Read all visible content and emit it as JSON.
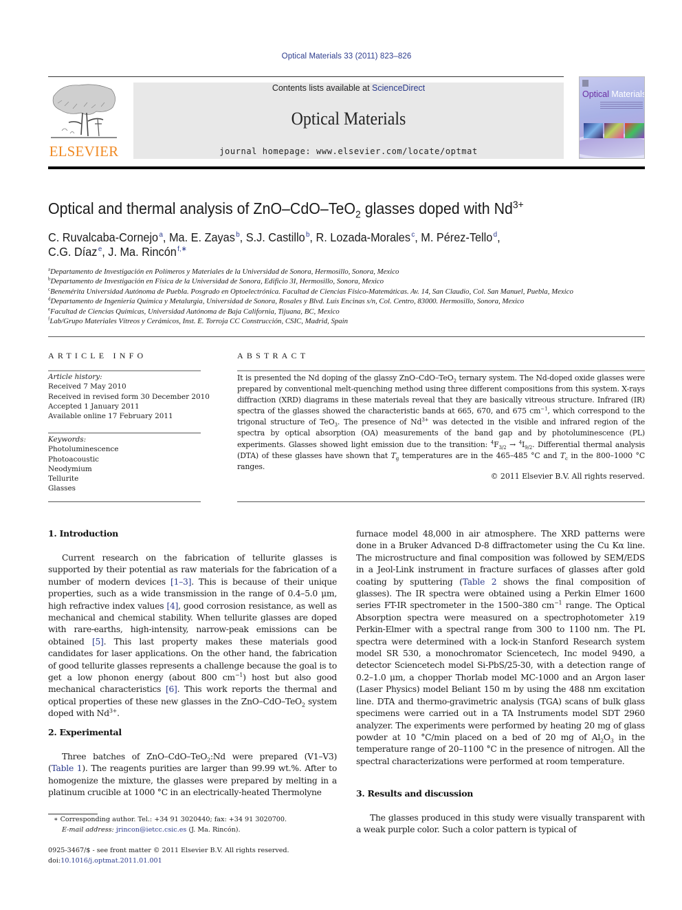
{
  "header": {
    "journal_reference": "Optical Materials 33 (2011) 823–826",
    "contents_prefix": "Contents lists available at ",
    "contents_link": "ScienceDirect",
    "journal_title": "Optical Materials",
    "homepage": "journal homepage: www.elsevier.com/locate/optmat",
    "publisher_logo_text": "ELSEVIER",
    "cover_title_part1": "Optical",
    "cover_title_part2": " Materials"
  },
  "colors": {
    "link": "#2b3a8c",
    "elsevier_orange": "#f08a24",
    "header_band": "#e8e8e8"
  },
  "article": {
    "title_main": "Optical and thermal analysis of ZnO–CdO–TeO",
    "title_sub": "2",
    "title_rest": " glasses doped with Nd",
    "title_sup": "3+",
    "authors": [
      {
        "name": "C. Ruvalcaba-Cornejo",
        "aff": "a",
        "sep": ", "
      },
      {
        "name": "Ma. E. Zayas",
        "aff": "b",
        "sep": ", "
      },
      {
        "name": "S.J. Castillo",
        "aff": "b",
        "sep": ", "
      },
      {
        "name": "R. Lozada-Morales",
        "aff": "c",
        "sep": ", "
      },
      {
        "name": "M. Pérez-Tello",
        "aff": "d",
        "sep": ","
      },
      {
        "name": "C.G. Díaz",
        "aff": "e",
        "sep": ", "
      },
      {
        "name": "J. Ma. Rincón",
        "aff": "f,∗",
        "sep": ""
      }
    ],
    "affiliations": [
      {
        "key": "a",
        "text": "Departamento de Investigación en Polímeros y Materiales de la Universidad de Sonora, Hermosillo, Sonora, Mexico"
      },
      {
        "key": "b",
        "text": "Departamento de Investigación en Física de la Universidad de Sonora, Edificio 3I, Hermosillo, Sonora, Mexico"
      },
      {
        "key": "c",
        "text": "Benemérita Universidad Autónoma de Puebla. Posgrado en Optoelectrónica. Facultad de Ciencias Físico-Matemáticas. Av. 14, San Claudio, Col. San Manuel, Puebla, Mexico"
      },
      {
        "key": "d",
        "text": "Departamento de Ingeniería Química y Metalurgia, Universidad de Sonora, Rosales y Blvd. Luís Encinas s/n, Col. Centro, 83000. Hermosillo, Sonora, Mexico"
      },
      {
        "key": "e",
        "text": "Facultad de Ciencias Químicas, Universidad Autónoma de Baja California, Tijuana, BC, Mexico"
      },
      {
        "key": "f",
        "text": "Lab/Grupo Materiales Vítreos y Cerámicos, Inst. E. Torroja CC Construcción, CSIC, Madrid, Spain"
      }
    ]
  },
  "article_info": {
    "heading": "ARTICLE INFO",
    "history_label": "Article history:",
    "history": [
      "Received 7 May 2010",
      "Received in revised form 30 December 2010",
      "Accepted 1 January 2011",
      "Available online 17 February 2011"
    ],
    "keywords_label": "Keywords:",
    "keywords": [
      "Photoluminescence",
      "Photoacoustic",
      "Neodymium",
      "Tellurite",
      "Glasses"
    ]
  },
  "abstract": {
    "heading": "ABSTRACT",
    "t1": "It is presented the Nd doping of the glassy ZnO–CdO–TeO",
    "t1_sub": "2",
    "t2": " ternary system. The Nd-doped oxide glasses were prepared by conventional melt-quenching method using three different compositions from this system. X-rays diffraction (XRD) diagrams in these materials reveal that they are basically vitreous structure. Infrared (IR) spectra of the glasses showed the characteristic bands at 665, 670, and 675 cm",
    "t2_sup": "−1",
    "t3": ", which correspond to the trigonal structure of TeO",
    "t3_sub": "3",
    "t4": ". The presence of Nd",
    "t4_sup": "3+",
    "t5": " was detected in the visible and infrared region of the spectra by optical absorption (OA) measurements of the band gap and by photoluminescence (PL) experiments. Glasses showed light emission due to the transition: ",
    "tr_a_sup": "4",
    "tr_a": "F",
    "tr_a_sub": "3/2",
    "tr_arrow": " → ",
    "tr_b_sup": "4",
    "tr_b": "I",
    "tr_b_sub": "9/2",
    "t6": ". Differential thermal analysis (DTA) of these glasses have shown that ",
    "tg": "T",
    "tg_sub": "g",
    "t7": " temperatures are in the 465–485 °C and ",
    "tc": "T",
    "tc_sub": "c",
    "t8": " in the 800–1000 °C ranges.",
    "copyright": "© 2011 Elsevier B.V. All rights reserved."
  },
  "sections": {
    "intro": {
      "heading": "1. Introduction",
      "p1": "Current research on the fabrication of tellurite glasses is supported by their potential as raw materials for the fabrication of a number of modern devices ",
      "ref1": "[1–3]",
      "p2": ". This is because of their unique properties, such as a wide transmission in the range of 0.4–5.0 μm, high refractive index values ",
      "ref2": "[4]",
      "p3": ", good corrosion resistance, as well as mechanical and chemical stability. When tellurite glasses are doped with rare-earths, high-intensity, narrow-peak emissions can be obtained ",
      "ref3": "[5]",
      "p4": ". This last property makes these materials good candidates for laser applications. On the other hand, the fabrication of good tellurite glasses represents a challenge because the goal is to get a low phonon energy (about 800 cm",
      "p4_sup": "−1",
      "p5": ") host but also good mechanical characteristics ",
      "ref4": "[6]",
      "p6": ". This work reports the thermal and optical properties of these new glasses in the ZnO–CdO–TeO",
      "p6_sub": "2",
      "p7": " system doped with Nd",
      "p7_sup": "3+",
      "p8": "."
    },
    "experimental": {
      "heading": "2. Experimental",
      "p1": "Three batches of ZnO–CdO–TeO",
      "p1_sub": "2",
      "p2": ":Nd were prepared (V1–V3) (",
      "ref1": "Table 1",
      "p3": "). The reagents purities are larger than 99.99 wt.%. After to homogenize the mixture, the glasses were prepared by melting in a platinum crucible at 1000 °C in an electrically-heated Thermolyne",
      "r1": "furnace model 48,000 in air atmosphere. The XRD patterns were done in a Bruker Advanced D-8 diffractometer using the Cu Kα line. The microstructure and final composition was followed by SEM/EDS in a Jeol-Link instrument in fracture surfaces of glasses after gold coating by sputtering (",
      "ref2": "Table 2",
      "r2": " shows the final composition of glasses). The IR spectra were obtained using a Perkin Elmer 1600 series FT-IR spectrometer in the 1500–380 cm",
      "r2_sup": "−1",
      "r3": " range. The Optical Absorption spectra were measured on a spectrophotometer λ19 Perkin-Elmer with a spectral range from 300 to 1100 nm. The PL spectra were determined with a lock-in Stanford Research system model SR 530, a monochromator Sciencetech, Inc model 9490, a detector Sciencetech model Si-PbS/25-30, with a detection range of 0.2–1.0 μm, a chopper Thorlab model MC-1000 and an Argon laser (Laser Physics) model Beliant 150 m by using the 488 nm excitation line. DTA and thermo-gravimetric analysis (TGA) scans of bulk glass specimens were carried out in a TA Instruments model SDT 2960 analyzer. The experiments were performed by heating 20 mg of glass powder at 10 °C/min placed on a bed of 20 mg of Al",
      "r3_sub1": "2",
      "r3b": "O",
      "r3_sub2": "3",
      "r4": " in the temperature range of 20–1100 °C in the presence of nitrogen. All the spectral characterizations were performed at room temperature."
    },
    "results": {
      "heading": "3. Results and discussion",
      "p1": "The glasses produced in this study were visually transparent with a weak purple color. Such a color pattern is typical of"
    }
  },
  "footnotes": {
    "corresponding": "∗ Corresponding author. Tel.: +34 91 3020440; fax: +34 91 3020700.",
    "email_label": "E-mail address: ",
    "email": "jrincon@ietcc.csic.es",
    "email_suffix": " (J. Ma. Rincón).",
    "issn": "0925-3467/$ - see front matter © 2011 Elsevier B.V. All rights reserved.",
    "doi_label": "doi:",
    "doi": "10.1016/j.optmat.2011.01.001"
  }
}
